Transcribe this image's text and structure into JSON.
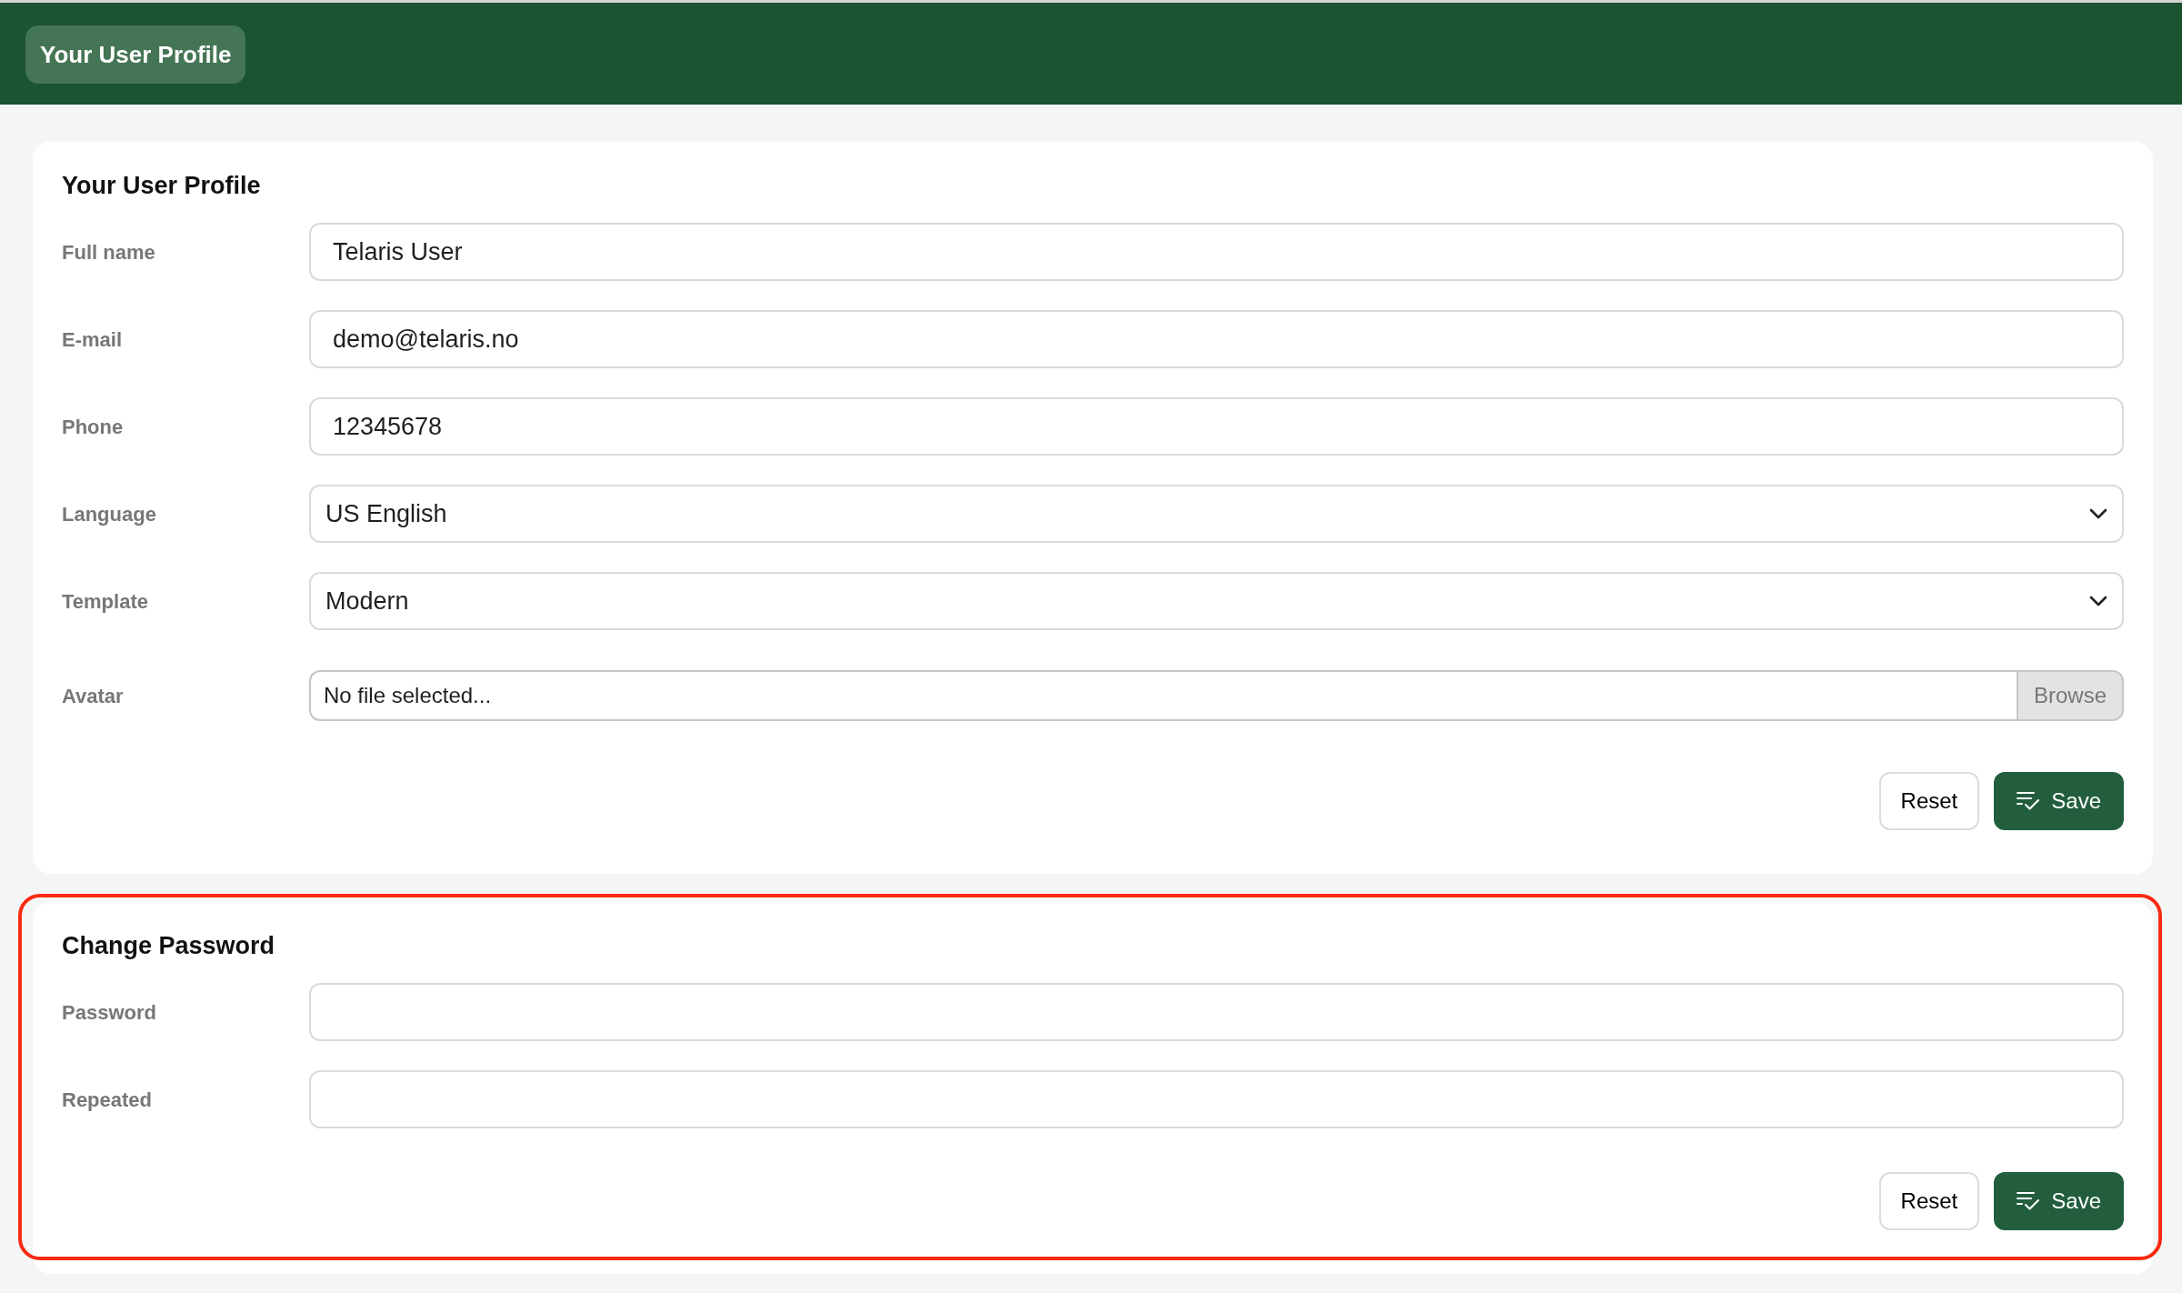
{
  "header": {
    "title": "Your User Profile"
  },
  "sections": [
    {
      "title": "Your User Profile",
      "highlighted": false,
      "fields": [
        {
          "kind": "text",
          "label": "Full name",
          "value": "Telaris User"
        },
        {
          "kind": "text",
          "label": "E-mail",
          "value": "demo@telaris.no"
        },
        {
          "kind": "text",
          "label": "Phone",
          "value": "12345678"
        },
        {
          "kind": "select",
          "label": "Language",
          "value": "US English"
        },
        {
          "kind": "select",
          "label": "Template",
          "value": "Modern"
        },
        {
          "kind": "file",
          "label": "Avatar",
          "value": "No file selected...",
          "button": "Browse"
        }
      ],
      "buttons": [
        {
          "kind": "secondary",
          "label": "Reset"
        },
        {
          "kind": "primary",
          "label": "Save"
        }
      ]
    },
    {
      "title": "Change Password",
      "highlighted": true,
      "fields": [
        {
          "kind": "password",
          "label": "Password"
        },
        {
          "kind": "password",
          "label": "Repeated"
        }
      ],
      "buttons": [
        {
          "kind": "secondary",
          "label": "Reset"
        },
        {
          "kind": "primary",
          "label": "Save"
        }
      ]
    }
  ]
}
